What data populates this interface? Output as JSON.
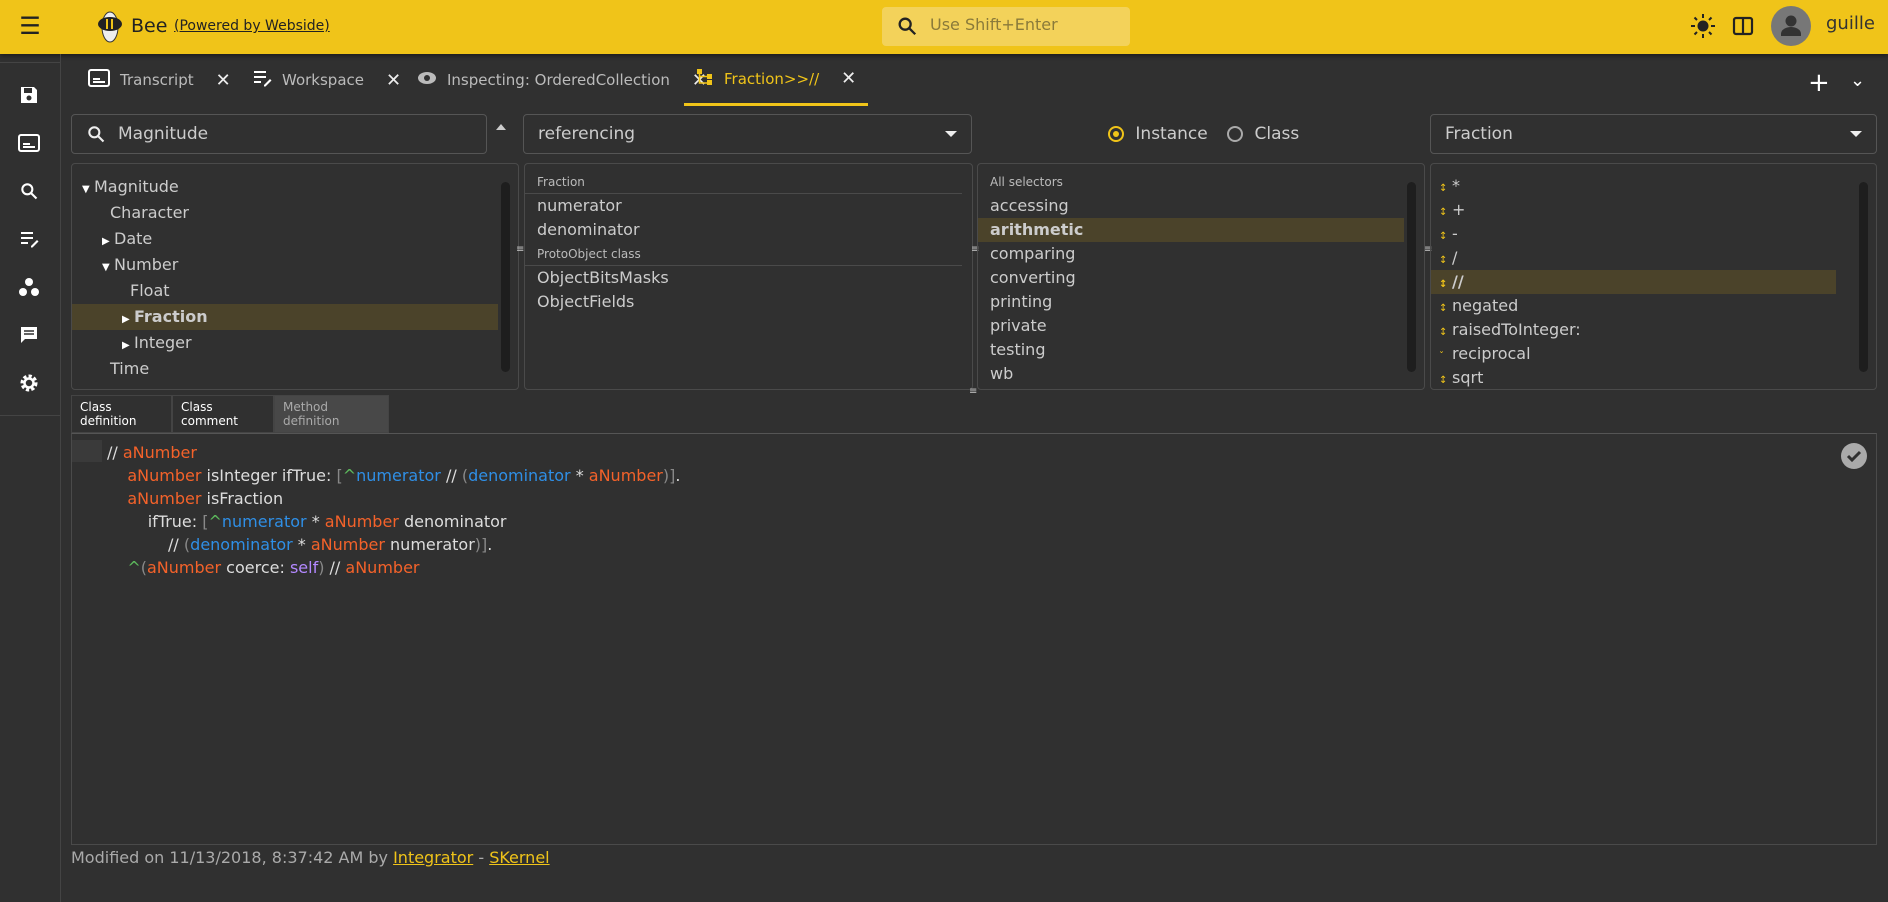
{
  "header": {
    "app_name": "Bee",
    "powered_by": "(Powered by Webside)",
    "search_placeholder": "Use Shift+Enter",
    "user": "guille",
    "accent": "#f0c419"
  },
  "sidebar": {
    "items": [
      {
        "icon": "save-icon"
      },
      {
        "icon": "transcript-icon"
      },
      {
        "icon": "search-icon"
      },
      {
        "icon": "workspace-icon"
      },
      {
        "icon": "packages-icon"
      },
      {
        "icon": "chat-icon"
      },
      {
        "icon": "settings-icon"
      }
    ]
  },
  "tabs": [
    {
      "label": "Transcript",
      "icon": "transcript-icon",
      "active": false
    },
    {
      "label": "Workspace",
      "icon": "workspace-icon",
      "active": false
    },
    {
      "label": "Inspecting: OrderedCollection",
      "icon": "eye-icon",
      "active": false
    },
    {
      "label": "Fraction>>//",
      "icon": "class-tree-icon",
      "active": true
    }
  ],
  "browser": {
    "class_search": "Magnitude",
    "variables_filter": "referencing",
    "side_instance": "Instance",
    "side_class": "Class",
    "side_selected": "Instance",
    "class_selector": "Fraction",
    "class_tree": [
      {
        "label": "Magnitude",
        "depth": 0,
        "expander": "expanded"
      },
      {
        "label": "Character",
        "depth": 1,
        "expander": "none"
      },
      {
        "label": "Date",
        "depth": 1,
        "expander": "collapsed"
      },
      {
        "label": "Number",
        "depth": 1,
        "expander": "expanded"
      },
      {
        "label": "Float",
        "depth": 2,
        "expander": "none"
      },
      {
        "label": "Fraction",
        "depth": 2,
        "expander": "collapsed",
        "selected": true
      },
      {
        "label": "Integer",
        "depth": 2,
        "expander": "collapsed"
      },
      {
        "label": "Time",
        "depth": 1,
        "expander": "none"
      }
    ],
    "variables": [
      {
        "header": "Fraction"
      },
      {
        "label": "numerator"
      },
      {
        "label": "denominator"
      },
      {
        "header": "ProtoObject class"
      },
      {
        "label": "ObjectBitsMasks"
      },
      {
        "label": "ObjectFields"
      }
    ],
    "categories_header": "All selectors",
    "categories": [
      "accessing",
      "arithmetic",
      "comparing",
      "converting",
      "printing",
      "private",
      "testing",
      "wb"
    ],
    "selected_category": "arithmetic",
    "selectors": [
      {
        "label": "*",
        "icon": "override-up-down-icon"
      },
      {
        "label": "+",
        "icon": "override-up-down-icon"
      },
      {
        "label": "-",
        "icon": "override-up-down-icon"
      },
      {
        "label": "/",
        "icon": "override-up-down-icon"
      },
      {
        "label": "//",
        "icon": "override-up-down-icon",
        "selected": true
      },
      {
        "label": "negated",
        "icon": "override-up-down-icon"
      },
      {
        "label": "raisedToInteger:",
        "icon": "override-up-down-icon"
      },
      {
        "label": "reciprocal",
        "icon": "override-down-icon"
      },
      {
        "label": "sqrt",
        "icon": "override-up-down-icon"
      }
    ]
  },
  "editor_tabs": [
    {
      "label": "Class definition",
      "active": false
    },
    {
      "label": "Class comment",
      "active": false
    },
    {
      "label": "Method definition",
      "active": true
    }
  ],
  "code_colors": {
    "argument": "#f4622a",
    "instvar": "#2f8fe6",
    "return": "#5cb85c",
    "self": "#b388ff"
  },
  "code": [
    [
      {
        "t": "// ",
        "c": "d"
      },
      {
        "t": "aNumber",
        "c": "o"
      }
    ],
    [
      {
        "t": "    ",
        "c": "d"
      },
      {
        "t": "aNumber",
        "c": "o"
      },
      {
        "t": " isInteger ifTrue: ",
        "c": "d"
      },
      {
        "t": "[",
        "c": "m"
      },
      {
        "t": "^",
        "c": "g"
      },
      {
        "t": "numerator",
        "c": "b"
      },
      {
        "t": " // ",
        "c": "d"
      },
      {
        "t": "(",
        "c": "m"
      },
      {
        "t": "denominator",
        "c": "b"
      },
      {
        "t": " * ",
        "c": "d"
      },
      {
        "t": "aNumber",
        "c": "o"
      },
      {
        "t": ")]",
        "c": "m"
      },
      {
        "t": ".",
        "c": "d"
      }
    ],
    [
      {
        "t": "    ",
        "c": "d"
      },
      {
        "t": "aNumber",
        "c": "o"
      },
      {
        "t": " isFraction",
        "c": "d"
      }
    ],
    [
      {
        "t": "        ifTrue: ",
        "c": "d"
      },
      {
        "t": "[",
        "c": "m"
      },
      {
        "t": "^",
        "c": "g"
      },
      {
        "t": "numerator",
        "c": "b"
      },
      {
        "t": " * ",
        "c": "d"
      },
      {
        "t": "aNumber",
        "c": "o"
      },
      {
        "t": " denominator",
        "c": "d"
      }
    ],
    [
      {
        "t": "            // ",
        "c": "d"
      },
      {
        "t": "(",
        "c": "m"
      },
      {
        "t": "denominator",
        "c": "b"
      },
      {
        "t": " * ",
        "c": "d"
      },
      {
        "t": "aNumber",
        "c": "o"
      },
      {
        "t": " numerator",
        "c": "d"
      },
      {
        "t": ")]",
        "c": "m"
      },
      {
        "t": ".",
        "c": "d"
      }
    ],
    [
      {
        "t": "    ",
        "c": "d"
      },
      {
        "t": "^",
        "c": "g"
      },
      {
        "t": "(",
        "c": "m"
      },
      {
        "t": "aNumber",
        "c": "o"
      },
      {
        "t": " coerce: ",
        "c": "d"
      },
      {
        "t": "self",
        "c": "p"
      },
      {
        "t": ")",
        "c": "m"
      },
      {
        "t": " // ",
        "c": "d"
      },
      {
        "t": "aNumber",
        "c": "o"
      }
    ]
  ],
  "footer": {
    "modified_prefix": "Modified on 11/13/2018, 8:37:42 AM by ",
    "author": "Integrator",
    "separator": " - ",
    "package": "SKernel"
  }
}
